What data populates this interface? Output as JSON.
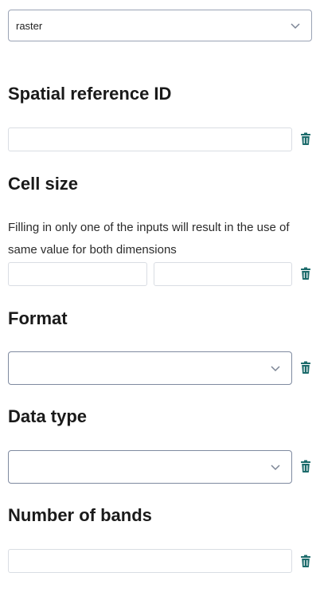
{
  "raster_select": {
    "value": "raster"
  },
  "sections": {
    "srid": {
      "title": "Spatial reference ID",
      "value": ""
    },
    "cell_size": {
      "title": "Cell size",
      "hint": "Filling in only one of the inputs will result in the use of same value for both dimensions",
      "x_value": "",
      "y_value": ""
    },
    "format": {
      "title": "Format",
      "value": ""
    },
    "data_type": {
      "title": "Data type",
      "value": ""
    },
    "bands": {
      "title": "Number of bands",
      "value": ""
    }
  },
  "icons": {
    "delete": "trash-icon",
    "dropdown": "chevron-down-icon",
    "delete_color": "#1c6b6b"
  }
}
